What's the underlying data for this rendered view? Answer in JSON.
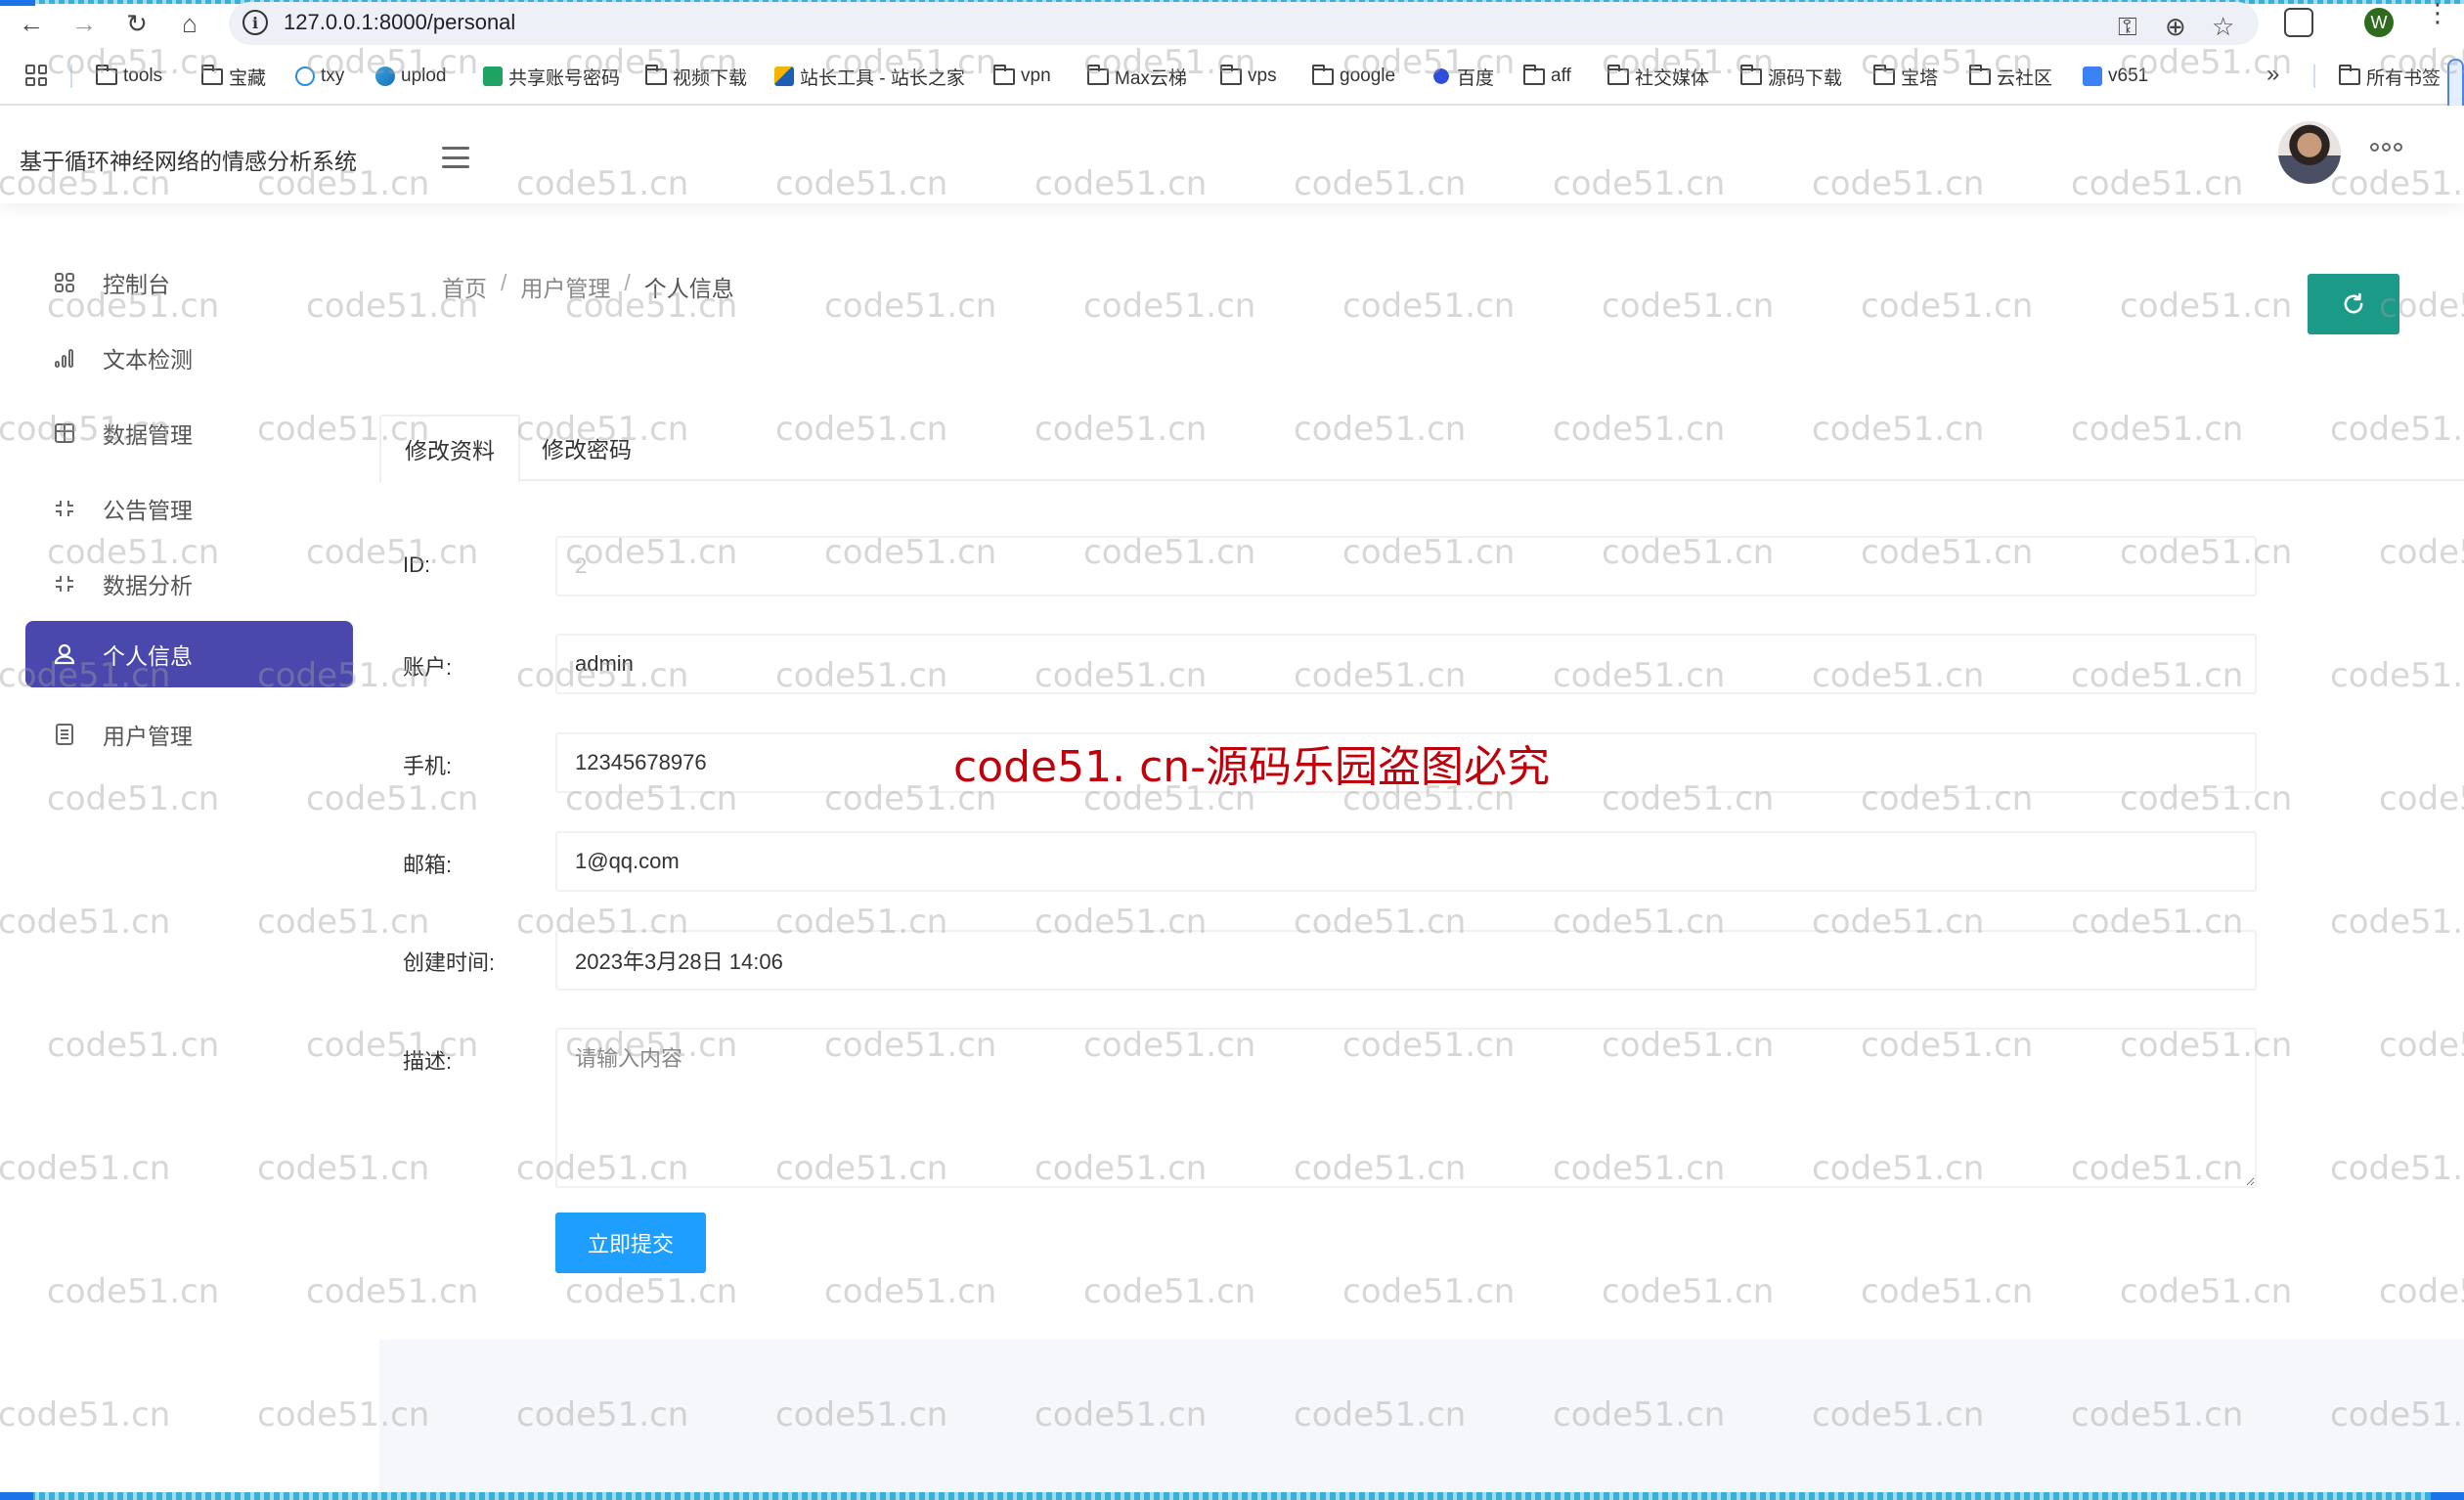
{
  "browser": {
    "url": "127.0.0.1:8000/personal",
    "bookmarks": [
      {
        "label": "tools",
        "icon": "folder-icon"
      },
      {
        "label": "宝藏",
        "icon": "folder-icon"
      },
      {
        "label": "txy",
        "icon": "cloud-icon"
      },
      {
        "label": "uplod",
        "icon": "upload-cloud-icon"
      },
      {
        "label": "共享账号密码",
        "icon": "sheets-icon"
      },
      {
        "label": "视频下载",
        "icon": "folder-icon"
      },
      {
        "label": "站长工具 - 站长之家",
        "icon": "site-icon"
      },
      {
        "label": "vpn",
        "icon": "folder-icon"
      },
      {
        "label": "Max云梯",
        "icon": "folder-icon"
      },
      {
        "label": "vps",
        "icon": "folder-icon"
      },
      {
        "label": "google",
        "icon": "folder-icon"
      },
      {
        "label": "百度",
        "icon": "baidu-icon"
      },
      {
        "label": "aff",
        "icon": "folder-icon"
      },
      {
        "label": "社交媒体",
        "icon": "folder-icon"
      },
      {
        "label": "源码下载",
        "icon": "folder-icon"
      },
      {
        "label": "宝塔",
        "icon": "folder-icon"
      },
      {
        "label": "云社区",
        "icon": "folder-icon"
      },
      {
        "label": "v651",
        "icon": "v-icon"
      }
    ],
    "more_bookmarks": "»",
    "all_bookmarks": "所有书签",
    "profile_initial": "W"
  },
  "header": {
    "title": "基于循环神经网络的情感分析系统"
  },
  "sidebar": {
    "items": [
      {
        "label": "控制台",
        "icon": "dashboard-icon",
        "active": false
      },
      {
        "label": "文本检测",
        "icon": "bar-chart-icon",
        "active": false
      },
      {
        "label": "数据管理",
        "icon": "table-icon",
        "active": false
      },
      {
        "label": "公告管理",
        "icon": "shrink-icon",
        "active": false
      },
      {
        "label": "数据分析",
        "icon": "shrink-icon",
        "active": false
      },
      {
        "label": "个人信息",
        "icon": "user-icon",
        "active": true
      },
      {
        "label": "用户管理",
        "icon": "document-icon",
        "active": false
      }
    ]
  },
  "breadcrumb": {
    "items": [
      "首页",
      "用户管理",
      "个人信息"
    ],
    "separator": "/"
  },
  "tabs": [
    {
      "label": "修改资料",
      "active": true
    },
    {
      "label": "修改密码",
      "active": false
    }
  ],
  "form": {
    "id": {
      "label": "ID:",
      "value": "2"
    },
    "account": {
      "label": "账户:",
      "value": "admin"
    },
    "phone": {
      "label": "手机:",
      "value": "12345678976"
    },
    "email": {
      "label": "邮箱:",
      "value": "1@qq.com"
    },
    "created": {
      "label": "创建时间:",
      "value": "2023年3月28日 14:06"
    },
    "description": {
      "label": "描述:",
      "value": "",
      "placeholder": "请输入内容"
    },
    "submit_label": "立即提交"
  },
  "watermark": {
    "text": "code51.cn",
    "notice": "code51. cn-源码乐园盗图必究"
  },
  "colors": {
    "sidebar_active": "#4a48ad",
    "refresh_button": "#1a9a87",
    "submit_button": "#1e9fff",
    "notice_red": "#c0000a"
  }
}
